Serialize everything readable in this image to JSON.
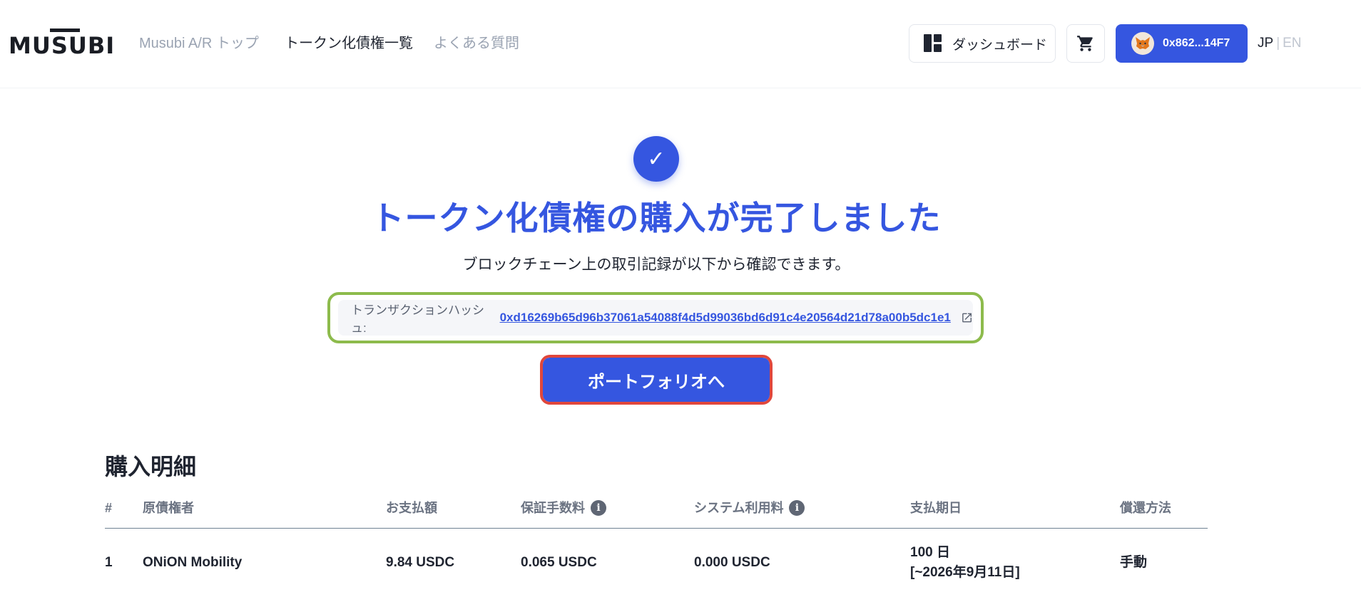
{
  "header": {
    "logo_text": "MUSUBI",
    "nav": {
      "top": "Musubi A/R トップ",
      "list": "トークン化債権一覧",
      "faq": "よくある質問"
    },
    "dashboard_label": "ダッシュボード",
    "wallet_address": "0x862...14F7",
    "lang": {
      "jp": "JP",
      "sep": "|",
      "en": "EN"
    }
  },
  "success": {
    "check": "✓",
    "title": "トークン化債権の購入が完了しました",
    "subtitle": "ブロックチェーン上の取引記録が以下から確認できます。",
    "hash_label": "トランザクションハッシュ:",
    "hash_value": "0xd16269b65d96b37061a54088f4d5d99036bd6d91c4e20564d21d78a00b5dc1e1",
    "portfolio_button": "ポートフォリオへ"
  },
  "details": {
    "title": "購入明細",
    "columns": [
      "#",
      "原債権者",
      "お支払額",
      "保証手数料",
      "システム利用料",
      "支払期日",
      "償還方法"
    ],
    "info_glyph": "i",
    "rows": [
      {
        "index": "1",
        "creditor": "ONiON Mobility",
        "payment": "9.84 USDC",
        "guarantee_fee": "0.065 USDC",
        "system_fee": "0.000 USDC",
        "due_days": "100 日",
        "due_date": "[~2026年9月11日]",
        "redemption": "手動"
      }
    ]
  },
  "colors": {
    "accent": "#3556e0",
    "hash_highlight": "#8dbb4c",
    "button_highlight": "#e0473c"
  }
}
